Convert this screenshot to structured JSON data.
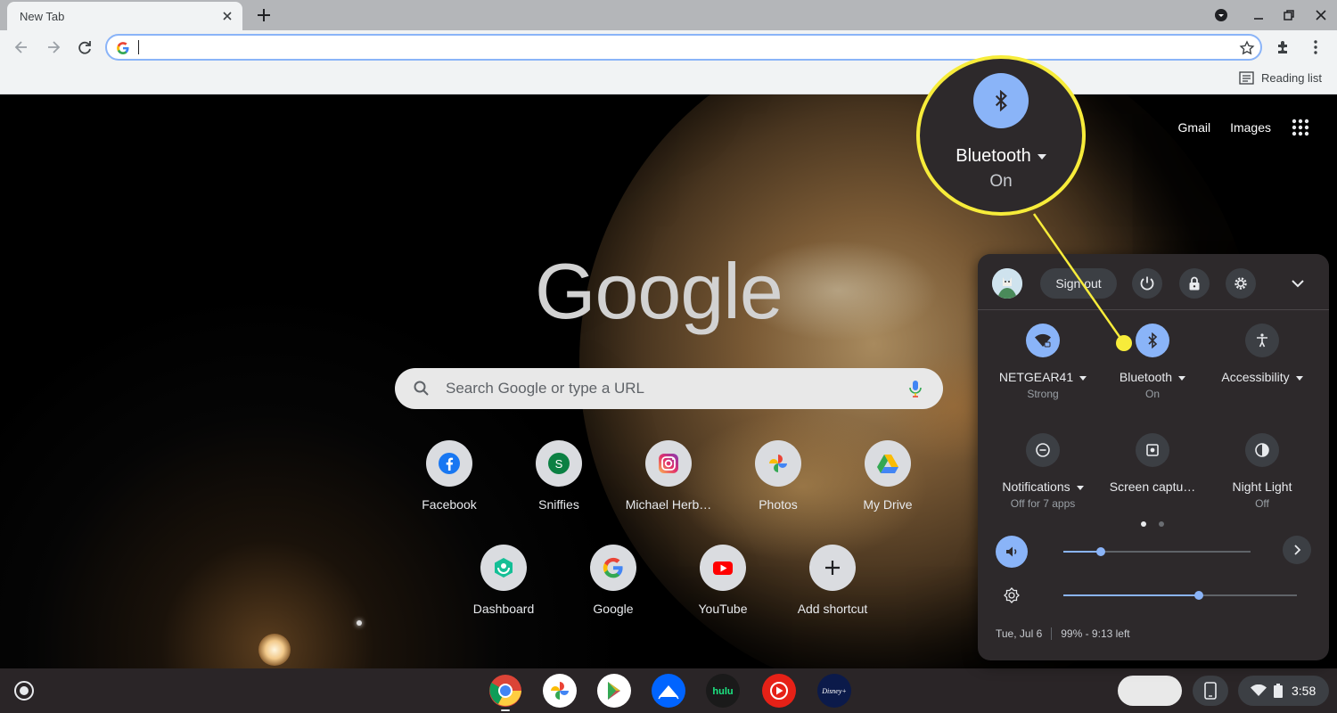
{
  "browser": {
    "tab_title": "New Tab",
    "reading_list_label": "Reading list"
  },
  "ntp": {
    "links": [
      "Gmail",
      "Images"
    ],
    "logo_text": "Google",
    "search_placeholder": "Search Google or type a URL",
    "shortcuts_row1": [
      "Facebook",
      "Sniffies",
      "Michael Herb…",
      "Photos",
      "My Drive"
    ],
    "shortcuts_row2": [
      "Dashboard",
      "Google",
      "YouTube",
      "Add shortcut"
    ],
    "sniffies_letter": "S"
  },
  "quick_settings": {
    "sign_out_label": "Sign out",
    "pods": [
      {
        "label": "NETGEAR41",
        "sub": "Strong",
        "icon": "wifi-icon"
      },
      {
        "label": "Bluetooth",
        "sub": "On",
        "icon": "bluetooth-icon"
      },
      {
        "label": "Accessibility",
        "sub": "",
        "icon": "accessibility-icon"
      },
      {
        "label": "Notifications",
        "sub": "Off for 7 apps",
        "icon": "notifications-off-icon"
      },
      {
        "label": "Screen captu…",
        "sub": "",
        "icon": "screen-capture-icon"
      },
      {
        "label": "Night Light",
        "sub": "Off",
        "icon": "night-light-icon"
      }
    ],
    "volume_level": 0.2,
    "brightness_level": 0.58,
    "date": "Tue, Jul 6",
    "battery": "99% - 9:13 left"
  },
  "callout": {
    "label": "Bluetooth",
    "status": "On"
  },
  "shelf": {
    "apps": [
      "chrome-icon",
      "photos-icon",
      "play-store-icon",
      "paramount-icon",
      "hulu-icon",
      "youtube-music-icon",
      "disney-plus-icon"
    ],
    "hulu_text": "hulu",
    "disney_text": "Disney+",
    "time": "3:58"
  },
  "colors": {
    "accent": "#8ab4f8",
    "callout": "#f7ec3a",
    "panel": "#2d292b"
  }
}
